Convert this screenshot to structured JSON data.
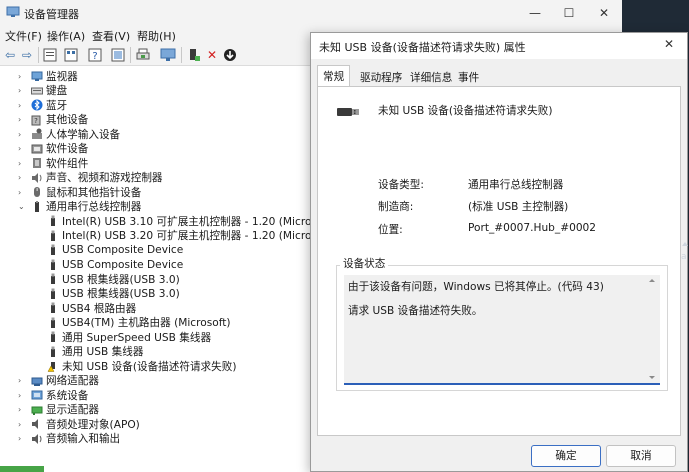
{
  "dm": {
    "title": "设备管理器",
    "caption": {
      "min": "—",
      "max": "☐",
      "close": "✕"
    },
    "menu": [
      "文件(F)",
      "操作(A)",
      "查看(V)",
      "帮助(H)"
    ],
    "tree": [
      {
        "label": "监视器",
        "icon": "monitor-icon",
        "chevron": "›"
      },
      {
        "label": "键盘",
        "icon": "keyboard-icon",
        "chevron": "›"
      },
      {
        "label": "蓝牙",
        "icon": "bluetooth-icon",
        "chevron": "›"
      },
      {
        "label": "其他设备",
        "icon": "unknown-device-icon",
        "chevron": "›"
      },
      {
        "label": "人体学输入设备",
        "icon": "hid-icon",
        "chevron": "›"
      },
      {
        "label": "软件设备",
        "icon": "software-device-icon",
        "chevron": "›"
      },
      {
        "label": "软件组件",
        "icon": "software-component-icon",
        "chevron": "›"
      },
      {
        "label": "声音、视频和游戏控制器",
        "icon": "speaker-icon",
        "chevron": "›"
      },
      {
        "label": "鼠标和其他指针设备",
        "icon": "mouse-icon",
        "chevron": "›"
      },
      {
        "label": "通用串行总线控制器",
        "icon": "usb-controller-icon",
        "chevron": "⌄"
      },
      {
        "label": "Intel(R) USB 3.10 可扩展主机控制器 - 1.20 (Microsoft)",
        "icon": "usb-plug-icon",
        "chevron": ""
      },
      {
        "label": "Intel(R) USB 3.20 可扩展主机控制器 - 1.20 (Microsoft)",
        "icon": "usb-plug-icon",
        "chevron": ""
      },
      {
        "label": "USB Composite Device",
        "icon": "usb-plug-icon",
        "chevron": ""
      },
      {
        "label": "USB Composite Device",
        "icon": "usb-plug-icon",
        "chevron": ""
      },
      {
        "label": "USB 根集线器(USB 3.0)",
        "icon": "usb-plug-icon",
        "chevron": ""
      },
      {
        "label": "USB 根集线器(USB 3.0)",
        "icon": "usb-plug-icon",
        "chevron": ""
      },
      {
        "label": "USB4 根路由器",
        "icon": "usb-plug-icon",
        "chevron": ""
      },
      {
        "label": "USB4(TM) 主机路由器 (Microsoft)",
        "icon": "usb-plug-icon",
        "chevron": ""
      },
      {
        "label": "通用 SuperSpeed USB 集线器",
        "icon": "usb-plug-icon",
        "chevron": ""
      },
      {
        "label": "通用 USB 集线器",
        "icon": "usb-plug-icon",
        "chevron": ""
      },
      {
        "label": "未知 USB 设备(设备描述符请求失败)",
        "icon": "usb-warning-icon",
        "chevron": ""
      },
      {
        "label": "网络适配器",
        "icon": "network-adapter-icon",
        "chevron": "›"
      },
      {
        "label": "系统设备",
        "icon": "system-device-icon",
        "chevron": "›"
      },
      {
        "label": "显示适配器",
        "icon": "display-adapter-icon",
        "chevron": "›"
      },
      {
        "label": "音频处理对象(APO)",
        "icon": "audio-apo-icon",
        "chevron": "›"
      },
      {
        "label": "音频输入和输出",
        "icon": "audio-io-icon",
        "chevron": "›"
      }
    ]
  },
  "dialog": {
    "title": "未知 USB 设备(设备描述符请求失败) 属性",
    "close": "✕",
    "tabs": [
      "常规",
      "驱动程序",
      "详细信息",
      "事件"
    ],
    "device_name": "未知 USB 设备(设备描述符请求失败)",
    "props": [
      {
        "label": "设备类型:",
        "value": "通用串行总线控制器"
      },
      {
        "label": "制造商:",
        "value": "(标准 USB 主控制器)"
      },
      {
        "label": "位置:",
        "value": "Port_#0007.Hub_#0002"
      }
    ],
    "status_group_label": "设备状态",
    "status_line_1": "由于该设备有问题，Windows 已将其停止。(代码 43)",
    "status_line_2": "请求 USB 设备描述符失败。",
    "ok": "确定",
    "cancel": "取消"
  },
  "edge_text": "a"
}
